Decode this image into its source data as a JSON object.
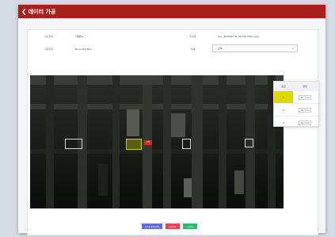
{
  "header": {
    "back_icon": "chevron-left-icon",
    "title": "데이터 가공"
  },
  "info": {
    "row1_label1": "검사항목",
    "row1_value1": "카메라1",
    "row1_label2": "파일명",
    "row1_value2": "CAL_2023-07-31_00101_0001.png",
    "row2_label1": "가공유형",
    "row2_value1": "Bounding Box",
    "row2_label2": "객체",
    "row2_select": "선택"
  },
  "selection_panel": {
    "col_index": "순번",
    "col_status": "상태",
    "rows": [
      {
        "index": "1",
        "status": "Normal"
      },
      {
        "index": "2",
        "status": "Normal"
      },
      {
        "index": "3",
        "status": "Normal"
      }
    ]
  },
  "image": {
    "bbox_tag": "선택"
  },
  "actions": {
    "reset_label": "초기화 데이터삭제",
    "delete_label": "삭제 취소",
    "save_label": "가공완료"
  },
  "colors": {
    "header": "#a8201c",
    "reset": "#5b6fd6",
    "delete": "#e2474b",
    "save": "#35b56a",
    "active": "#ddd800"
  }
}
